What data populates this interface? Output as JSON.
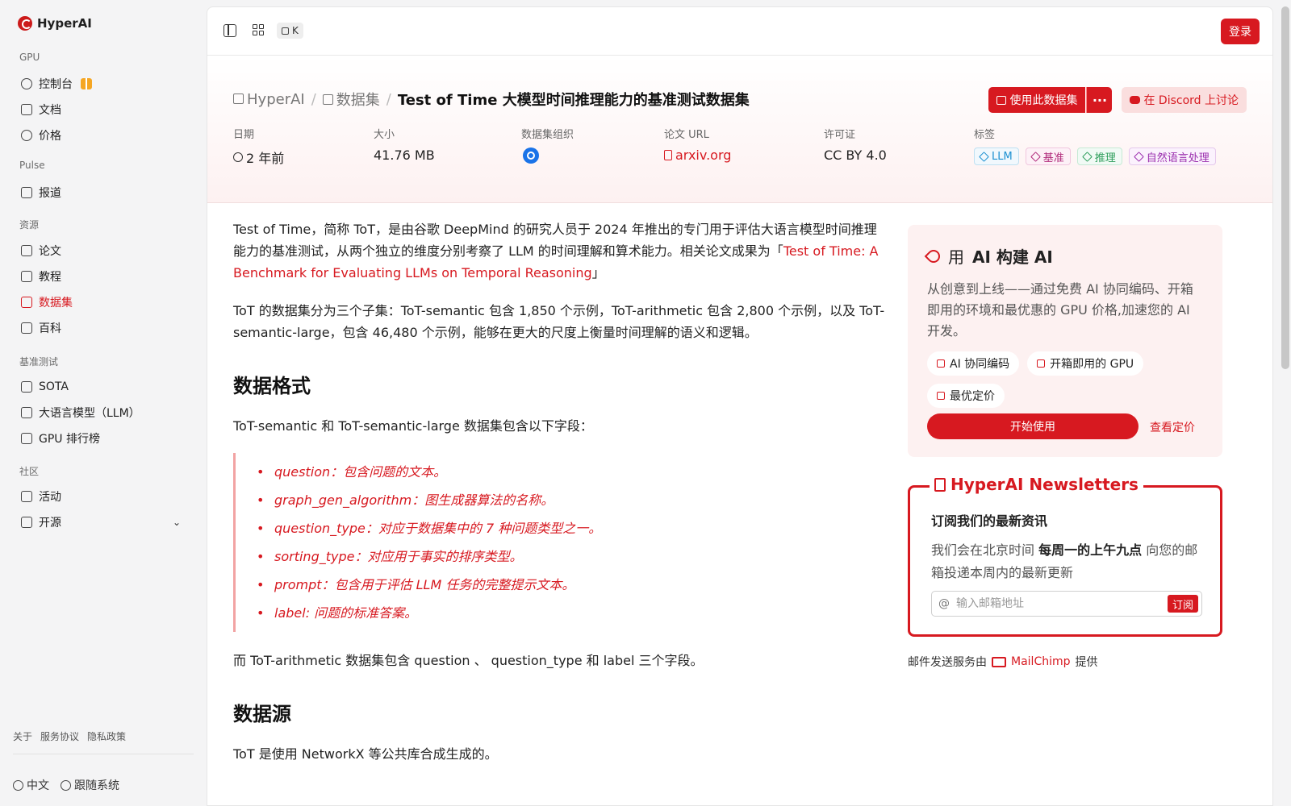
{
  "brand": {
    "name": "HyperAI"
  },
  "sidebar": {
    "sections": [
      {
        "label": "GPU"
      },
      {
        "label": "Pulse"
      },
      {
        "label": "资源"
      },
      {
        "label": "基准测试"
      },
      {
        "label": "社区"
      }
    ],
    "items": [
      {
        "label": "控制台",
        "icon": "dashboard-icon"
      },
      {
        "label": "文档",
        "icon": "document-icon"
      },
      {
        "label": "价格",
        "icon": "dollar-icon"
      },
      {
        "label": "报道",
        "icon": "news-icon"
      },
      {
        "label": "论文",
        "icon": "paper-icon"
      },
      {
        "label": "教程",
        "icon": "book-icon"
      },
      {
        "label": "数据集",
        "icon": "database-icon",
        "active": true
      },
      {
        "label": "百科",
        "icon": "wiki-icon"
      },
      {
        "label": "SOTA",
        "icon": "bar-chart-icon"
      },
      {
        "label": "大语言模型（LLM）",
        "icon": "sparkles-icon"
      },
      {
        "label": "GPU 排行榜",
        "icon": "chip-icon"
      },
      {
        "label": "活动",
        "icon": "calendar-icon"
      },
      {
        "label": "开源",
        "icon": "list-icon"
      }
    ],
    "footer_links": [
      "关于",
      "服务协议",
      "隐私政策"
    ],
    "language": "中文",
    "theme": "跟随系统"
  },
  "topbar": {
    "shortcut": "K",
    "login": "登录"
  },
  "header": {
    "breadcrumb": [
      "HyperAI",
      "数据集"
    ],
    "title": "Test of Time 大模型时间推理能力的基准测试数据集",
    "use_button": "使用此数据集",
    "more_button": "···",
    "discord_button": "在 Discord 上讨论",
    "meta": {
      "date_label": "日期",
      "date_value": "2 年前",
      "size_label": "大小",
      "size_value": "41.76 MB",
      "org_label": "数据集组织",
      "paper_label": "论文 URL",
      "paper_value": "arxiv.org",
      "license_label": "许可证",
      "license_value": "CC BY 4.0",
      "tags_label": "标签"
    },
    "tags": [
      {
        "label": "LLM",
        "color": "#1a8fd1"
      },
      {
        "label": "基准",
        "color": "#b0297a"
      },
      {
        "label": "推理",
        "color": "#2e9e5b"
      },
      {
        "label": "自然语言处理",
        "color": "#9b2fae"
      }
    ]
  },
  "article": {
    "p1_a": "Test of Time，简称 ToT，是由谷歌 DeepMind 的研究人员于 2024 年推出的专门用于评估大语言模型时间推理能力的基准测试，从两个独立的维度分别考察了 LLM 的时间理解和算术能力。相关论文成果为「",
    "p1_link": "Test of Time: A Benchmark for Evaluating LLMs on Temporal Reasoning",
    "p1_b": "」",
    "p2": "ToT 的数据集分为三个子集：ToT-semantic 包含 1,850 个示例，ToT-arithmetic 包含 2,800 个示例，以及 ToT-semantic-large，包含 46,480 个示例，能够在更大的尺度上衡量时间理解的语义和逻辑。",
    "h_format": "数据格式",
    "p3": "ToT-semantic 和 ToT-semantic-large 数据集包含以下字段：",
    "fields": [
      "question：包含问题的文本。",
      "graph_gen_algorithm：图生成器算法的名称。",
      "question_type：对应于数据集中的 7 种问题类型之一。",
      "sorting_type：对应用于事实的排序类型。",
      "prompt：包含用于评估 LLM 任务的完整提示文本。",
      "label: 问题的标准答案。"
    ],
    "p4": "而 ToT-arithmetic 数据集包含 question 、 question_type 和 label 三个字段。",
    "h_source": "数据源",
    "p5": "ToT 是使用 NetworkX 等公共库合成生成的。"
  },
  "ai_card": {
    "title_prefix": "用",
    "title_bold": "AI 构建 AI",
    "desc": "从创意到上线——通过免费 AI 协同编码、开箱即用的环境和最优惠的 GPU 价格,加速您的 AI 开发。",
    "chips": [
      "AI 协同编码",
      "开箱即用的 GPU",
      "最优定价"
    ],
    "cta": "开始使用",
    "pricing": "查看定价"
  },
  "newsletter": {
    "title": "HyperAI Newsletters",
    "heading": "订阅我们的最新资讯",
    "desc_a": "我们会在北京时间 ",
    "desc_bold": "每周一的上午九点",
    "desc_b": " 向您的邮箱投递本周内的最新更新",
    "placeholder": "输入邮箱地址",
    "subscribe": "订阅",
    "footer_a": "邮件发送服务由",
    "footer_brand": "MailChimp",
    "footer_b": "提供"
  },
  "colors": {
    "accent": "#d71920"
  }
}
